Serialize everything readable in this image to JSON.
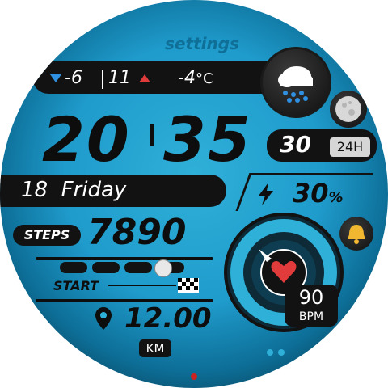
{
  "header": {
    "settings_label": "settings"
  },
  "weather": {
    "low": "-6",
    "high": "11",
    "temperature": "-4",
    "unit": "°C",
    "condition_icon": "rain-cloud-icon"
  },
  "time": {
    "hours": "20",
    "minutes": "35"
  },
  "date": {
    "day": "18",
    "weekday": "Friday",
    "day_of_month": "30",
    "format": "24H"
  },
  "battery": {
    "value": "30",
    "unit": "%"
  },
  "steps": {
    "label": "STEPS",
    "value": "7890"
  },
  "progress": {
    "start_label": "START",
    "fraction": 0.78
  },
  "distance": {
    "value": "12.00",
    "unit": "KM"
  },
  "heart": {
    "value": "90",
    "unit": "BPM"
  },
  "icons": {
    "moon": "moon-phase-icon",
    "alarm": "bell-icon",
    "flag": "checkered-flag-icon",
    "location": "map-pin-icon"
  },
  "colors": {
    "accent": "#2fb0d8",
    "dark": "#121212",
    "heart": "#e23b3b",
    "arrow_down": "#2f8fe0",
    "arrow_up": "#e03b3b"
  }
}
